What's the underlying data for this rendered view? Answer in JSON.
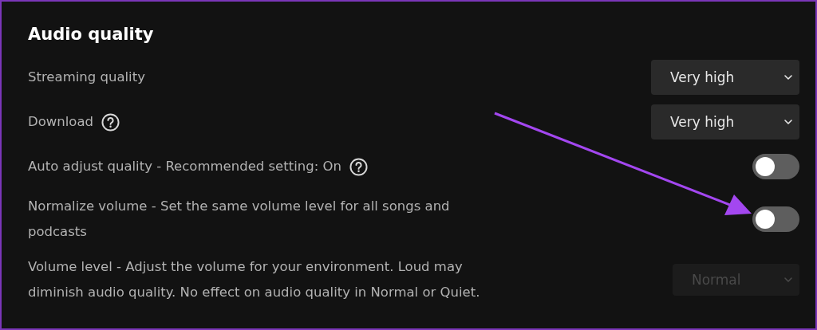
{
  "section": {
    "title": "Audio quality"
  },
  "settings": [
    {
      "kind": "dropdown",
      "label": "Streaming quality",
      "help": false,
      "value": "Very high",
      "disabled": false
    },
    {
      "kind": "dropdown",
      "label": "Download",
      "help": true,
      "value": "Very high",
      "disabled": false
    },
    {
      "kind": "toggle",
      "label": "Auto adjust quality - Recommended setting: On",
      "help": true,
      "on": false
    },
    {
      "kind": "toggle",
      "label": "Normalize volume - Set the same volume level for all songs and podcasts",
      "help": false,
      "on": false
    },
    {
      "kind": "dropdown",
      "label": "Volume level - Adjust the volume for your environment. Loud may diminish audio quality. No effect on audio quality in Normal or Quiet.",
      "help": false,
      "value": "Normal",
      "disabled": true
    }
  ]
}
